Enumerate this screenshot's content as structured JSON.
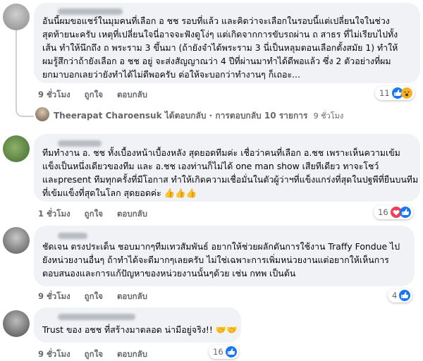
{
  "comments": [
    {
      "lines": [
        "อันนี้ผมขอแชร์ในมุมคนที่เลือก อ ชช รอบที่แล้ว และคิดว่าจะเลือกในรอบนี้แต่เปลี่ยนใจในช่วง",
        "สุดท้ายนะครับ เหตุที่เปลี่ยนใจนี่อาจจะฟังดูโง่ๆ แต่เกิดจากการขับรถผ่าน ถ สาธร ที่ไม่เรียบไปทั้ง",
        "เส้น ทำให้นึกถึง ถ พระราม 3 ขึ้นมา (ถ้ายังจำได้พระราม 3 นี่เป็นหลุมตอนเลือกตั้งสมัย 1) ทำให้",
        "ผมรู้สึกว่าถ้ายังเลือก อ ชช อยู่ จะส่งสัญญาณว่า 4 ปีที่ผ่านมาทำได้ดีพอแล้ว ซึ่ง 2 ตัวอย่างที่ผม",
        "ยกมาบอกเลยว่ายังทำได้ไม่ดีพอครับ ต่อให้จะบอกว่าทำงานๆ ก็เถอะ..."
      ],
      "time": "9 ชั่วโมง",
      "like": "ถูกใจ",
      "reply": "ตอบกลับ",
      "reaction_count": "11"
    },
    {
      "lines": [
        "ทีมทำงาน อ. ชช ทั้งเบื้องหน้าเบื้องหลัง สุดยอดทีมค่ะ เชื่อว่าคนที่เลือก อ.ชช เพราะเห็นความเข้ม",
        "แข็งเป็นหนึ่งเดียวของทีม และ อ.ชช เองท่านก็ไม่ได้ one man show เสียทีเดียว ทาจะโชว์",
        "และpresent ทีมทุกครั้งที่มีโอกาส ทำให้เกิดความเชื่อมั่นในตัวผู้ว่าฯที่แข็งแกร่งที่สุดในปฐพีที่ยืนบนทีม",
        "ที่เข้มแข็งที่สุดในโลก สุดยอดค่ะ 👍👍👍"
      ],
      "time": "1 ชั่วโมง",
      "like": "ถูกใจ",
      "reply": "ตอบกลับ",
      "reaction_count": "16"
    },
    {
      "lines": [
        "ชัดเจน ตรงประเด็น ชอบมากๆทีมเทวสัมพันธ์ อยากให้ช่วยผลักดันการใช้งาน Traffy Fondue ไป",
        "ยังหน่วยงานอื่นๆ ถ้าทำได้จะดีมากๆเลยครับ ไม่ใช่เฉพาะการเพิ่มหน่วยงานแต่อยากให้เห็นการ",
        "ตอบสนองและการแก้ปัญหาของหน่วยงานนั้นๆด้วย เช่น กทพ เป็นต้น"
      ],
      "time": "9 ชั่วโมง",
      "like": "ถูกใจ",
      "reply": "ตอบกลับ",
      "reaction_count": "4"
    },
    {
      "lines": [
        "Trust ของ อชช ที่สร้างมาตลอด น่ามีอยู่จริง!! 🤝🤝"
      ],
      "time": "9 ชั่วโมง",
      "like": "ถูกใจ",
      "reply": "ตอบกลับ",
      "reaction_count": "16"
    }
  ],
  "reply_thread": {
    "name": "Theerapat Charoensuk",
    "text": " ได้ตอบกลับ · การตอบกลับ 10 รายการ",
    "time": "9 ชั่วโมง"
  },
  "colors": {
    "like": "#1877f2",
    "haha": "#f7b125",
    "love": "#f33e58",
    "bubble": "#f0f2f5"
  }
}
